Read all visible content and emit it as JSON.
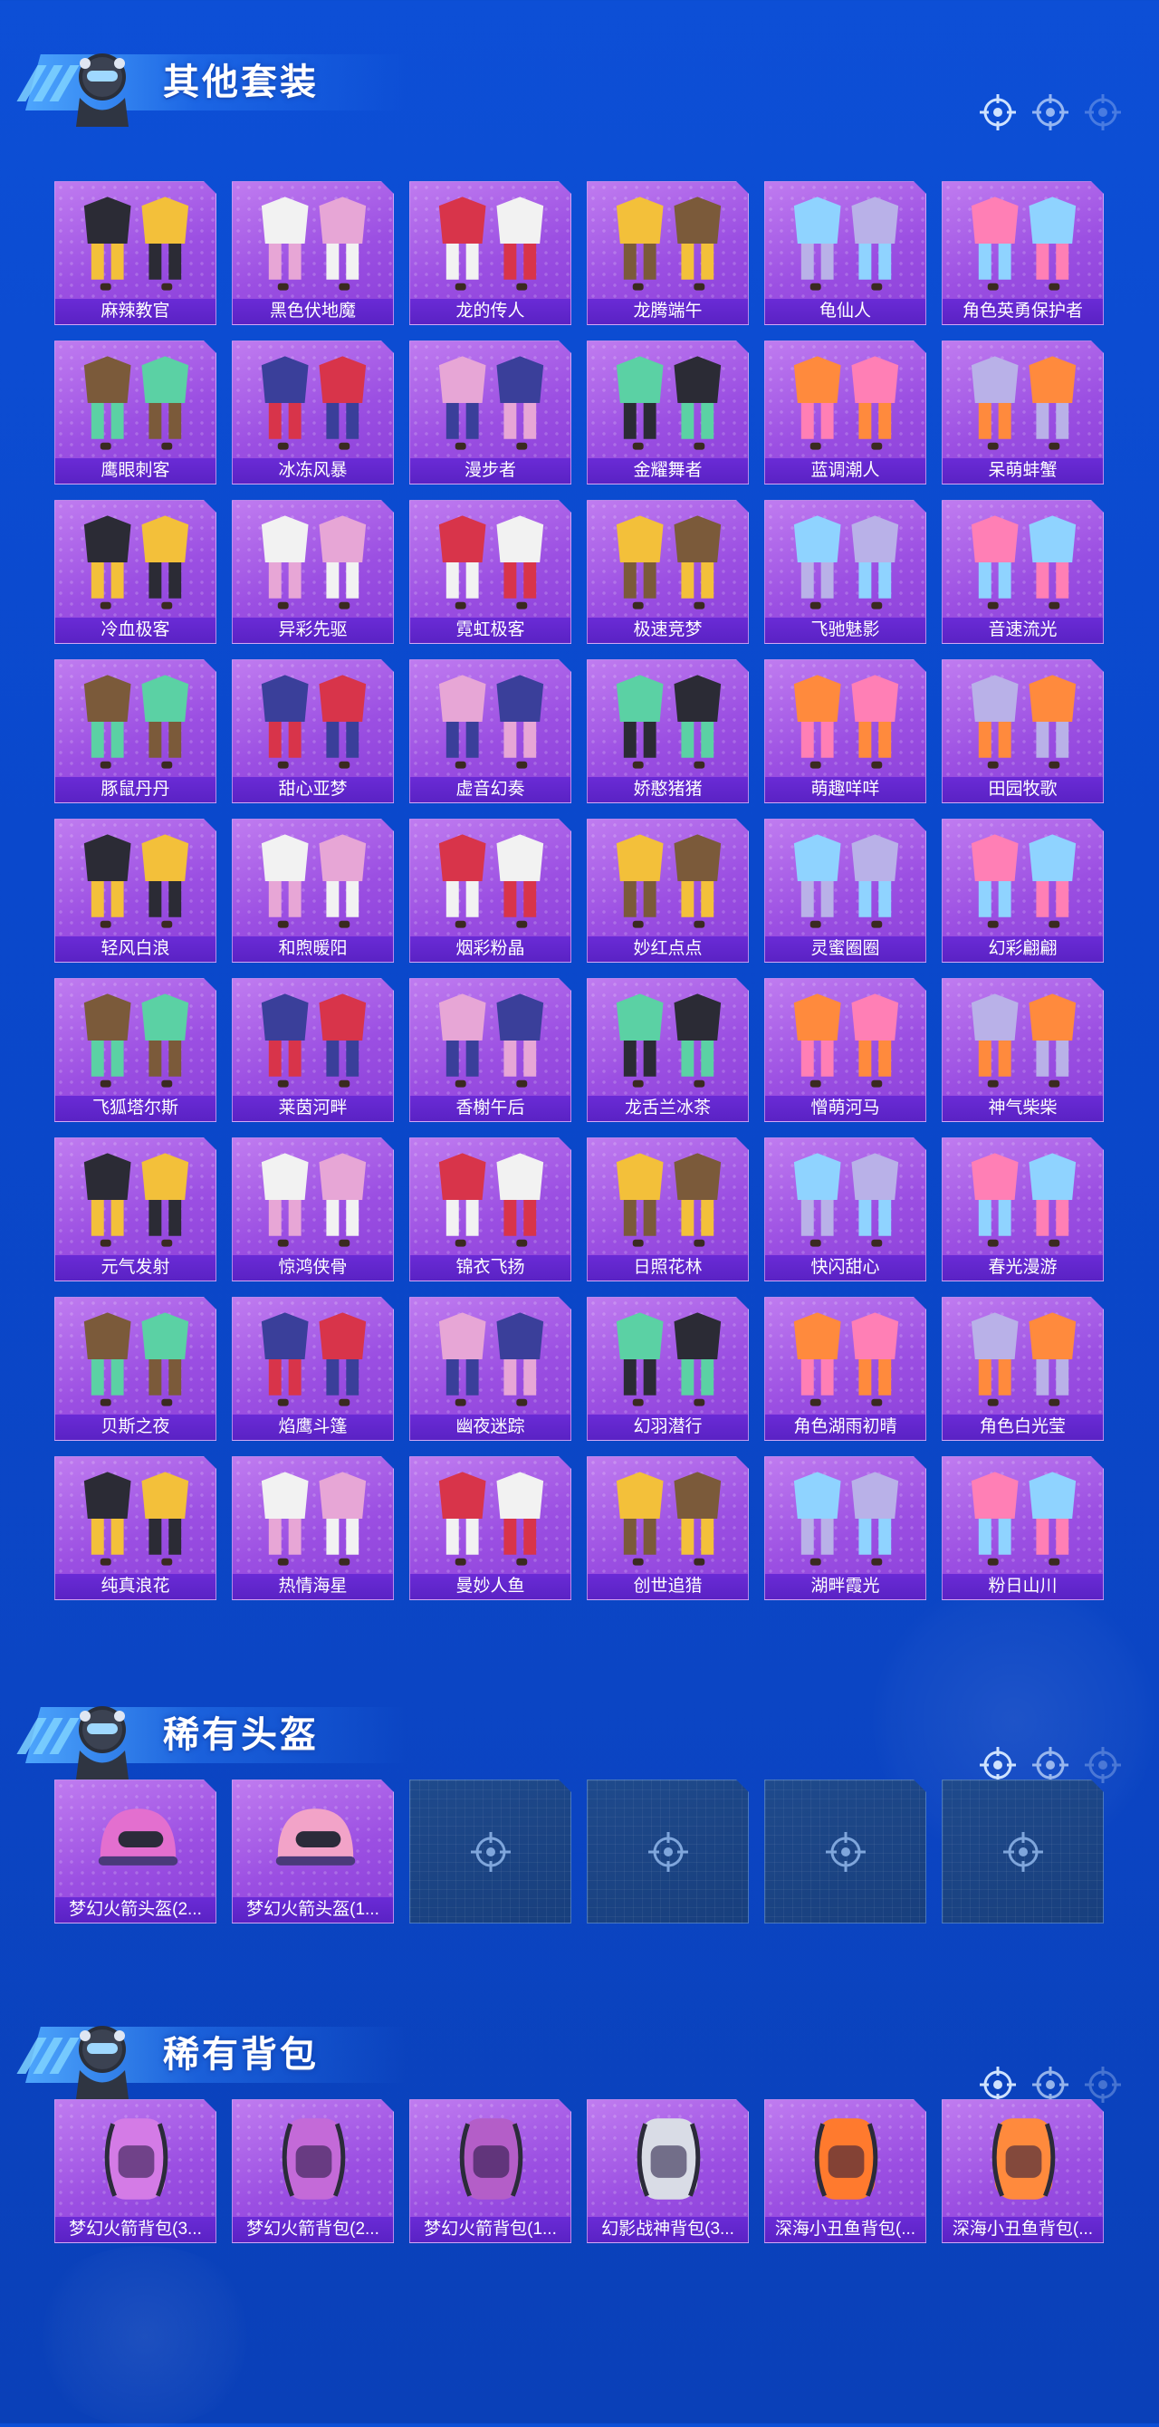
{
  "sections": {
    "suits": {
      "title": "其他套装",
      "items": [
        "麻辣教官",
        "黑色伏地魔",
        "龙的传人",
        "龙腾端午",
        "龟仙人",
        "角色英勇保护者",
        "鹰眼刺客",
        "冰冻风暴",
        "漫步者",
        "金耀舞者",
        "蓝调潮人",
        "呆萌蚌蟹",
        "冷血极客",
        "异彩先驱",
        "霓虹极客",
        "极速竞梦",
        "飞驰魅影",
        "音速流光",
        "豚鼠丹丹",
        "甜心亚梦",
        "虚音幻奏",
        "娇憨猪猪",
        "萌趣咩咩",
        "田园牧歌",
        "轻风白浪",
        "和煦暖阳",
        "烟彩粉晶",
        "妙红点点",
        "灵蜜圈圈",
        "幻彩翩翩",
        "飞狐塔尔斯",
        "莱茵河畔",
        "香榭午后",
        "龙舌兰冰茶",
        "憎萌河马",
        "神气柴柴",
        "元气发射",
        "惊鸿侠骨",
        "锦衣飞扬",
        "日照花林",
        "快闪甜心",
        "春光漫游",
        "贝斯之夜",
        "焰鹰斗篷",
        "幽夜迷踪",
        "幻羽潜行",
        "角色湖雨初晴",
        "角色白光莹",
        "纯真浪花",
        "热情海星",
        "曼妙人鱼",
        "创世追猎",
        "湖畔霞光",
        "粉日山川"
      ]
    },
    "helmets": {
      "title": "稀有头盔",
      "items": [
        "梦幻火箭头盔(2...",
        "梦幻火箭头盔(1..."
      ],
      "empty_slots": 4
    },
    "backpacks": {
      "title": "稀有背包",
      "items": [
        "梦幻火箭背包(3...",
        "梦幻火箭背包(2...",
        "梦幻火箭背包(1...",
        "幻影战神背包(3...",
        "深海小丑鱼背包(...",
        "深海小丑鱼背包(..."
      ]
    }
  },
  "colors": {
    "background": "#0b48cc",
    "card_purple": "#9b4fe2",
    "label_band": "#5f25c9",
    "empty_slot": "#1c4585"
  }
}
